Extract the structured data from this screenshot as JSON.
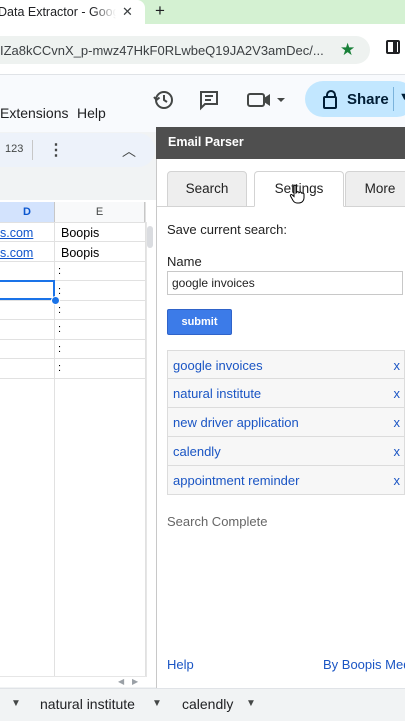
{
  "browser": {
    "tab_title": "Data Extractor - Google Sheets",
    "tab_close": "✕",
    "new_tab": "+",
    "url": "IZa8kCCvnX_p-mwz47HkF0RLwbeQ19JA2V3amDec/..."
  },
  "sheets": {
    "menus": [
      "Extensions",
      "Help"
    ],
    "share_label": "Share",
    "toolbar": {
      "format_label": "123"
    },
    "columns": [
      "D",
      "E"
    ],
    "rows": [
      {
        "d": "s.com",
        "e": "Boopis"
      },
      {
        "d": "s.com",
        "e": "Boopis"
      }
    ],
    "colon_rows": [
      ":",
      ":",
      ":",
      ":",
      ":",
      ":"
    ],
    "sheet_tabs": [
      "natural institute",
      "calendly"
    ]
  },
  "panel": {
    "title": "Email Parser",
    "tabs": [
      "Search",
      "Settings",
      "More"
    ],
    "save_label": "Save current search:",
    "name_label": "Name",
    "name_value": "google invoices",
    "submit_label": "submit",
    "saved_searches": [
      {
        "name": "google invoices",
        "remove": "x"
      },
      {
        "name": "natural institute",
        "remove": "x"
      },
      {
        "name": "new driver application",
        "remove": "x"
      },
      {
        "name": "calendly",
        "remove": "x"
      },
      {
        "name": "appointment reminder",
        "remove": "x"
      }
    ],
    "status": "Search Complete",
    "footer_help": "Help",
    "footer_credit": "By Boopis Media"
  },
  "colors": {
    "accent_blue": "#3c7be8",
    "link_blue": "#1a55c4",
    "share_bg": "#c2e7ff",
    "panel_header": "#4f4f4f"
  }
}
